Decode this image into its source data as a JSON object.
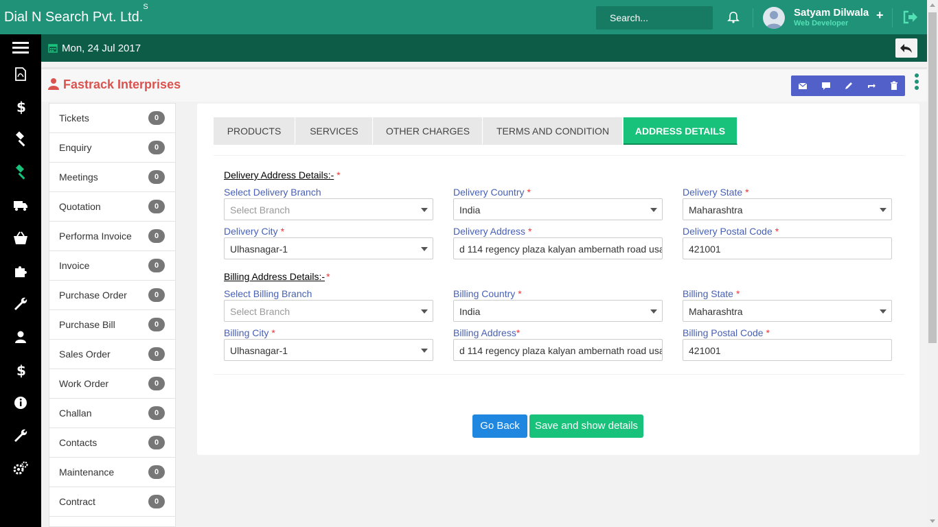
{
  "app": {
    "brand": "Dial N Search Pvt. Ltd.",
    "brand_sup": "S"
  },
  "header": {
    "search_placeholder": "Search...",
    "user_name": "Satyam Dilwala",
    "user_role": "Web Developer"
  },
  "subbar": {
    "date": "Mon, 24 Jul 2017"
  },
  "page": {
    "company": "Fastrack Interprises"
  },
  "sidebar": {
    "items": [
      {
        "label": "Tickets",
        "count": "0"
      },
      {
        "label": "Enquiry",
        "count": "0"
      },
      {
        "label": "Meetings",
        "count": "0"
      },
      {
        "label": "Quotation",
        "count": "0"
      },
      {
        "label": "Performa Invoice",
        "count": "0"
      },
      {
        "label": "Invoice",
        "count": "0"
      },
      {
        "label": "Purchase Order",
        "count": "0"
      },
      {
        "label": "Purchase Bill",
        "count": "0"
      },
      {
        "label": "Sales Order",
        "count": "0"
      },
      {
        "label": "Work Order",
        "count": "0"
      },
      {
        "label": "Challan",
        "count": "0"
      },
      {
        "label": "Contacts",
        "count": "0"
      },
      {
        "label": "Maintenance",
        "count": "0"
      },
      {
        "label": "Contract",
        "count": "0"
      }
    ]
  },
  "tabs": [
    "PRODUCTS",
    "SERVICES",
    "OTHER CHARGES",
    "TERMS AND CONDITION",
    "ADDRESS DETAILS"
  ],
  "delivery": {
    "heading": "Delivery Address Details:-",
    "branch_label": "Select Delivery Branch",
    "branch_value": "Select Branch",
    "country_label": "Delivery Country",
    "country_value": "India",
    "state_label": "Delivery State",
    "state_value": "Maharashtra",
    "city_label": "Delivery City",
    "city_value": "Ulhasnagar-1",
    "address_label": "Delivery Address",
    "address_value": "d 114 regency plaza kalyan ambernath road usa",
    "postal_label": "Delivery Postal Code",
    "postal_value": "421001"
  },
  "billing": {
    "heading": "Billing Address Details:-",
    "branch_label": "Select Billing Branch",
    "branch_value": "Select Branch",
    "country_label": "Billing Country",
    "country_value": "India",
    "state_label": "Billing State",
    "state_value": "Maharashtra",
    "city_label": "Billing City",
    "city_value": "Ulhasnagar-1",
    "address_label": "Billing Address",
    "address_value": "d 114 regency plaza kalyan ambernath road usa",
    "postal_label": "Billing Postal Code",
    "postal_value": "421001"
  },
  "buttons": {
    "back": "Go Back",
    "save": "Save and show details"
  },
  "colors": {
    "primary": "#1f9278",
    "dark": "#0d5c48",
    "accent": "#19c27a",
    "danger": "#d9534f",
    "label": "#4760b5"
  },
  "icons": [
    "bell-icon",
    "logout-icon",
    "calendar-icon",
    "user-icon",
    "mail-icon",
    "comment-icon",
    "edit-icon",
    "refresh-icon",
    "trash-icon"
  ]
}
